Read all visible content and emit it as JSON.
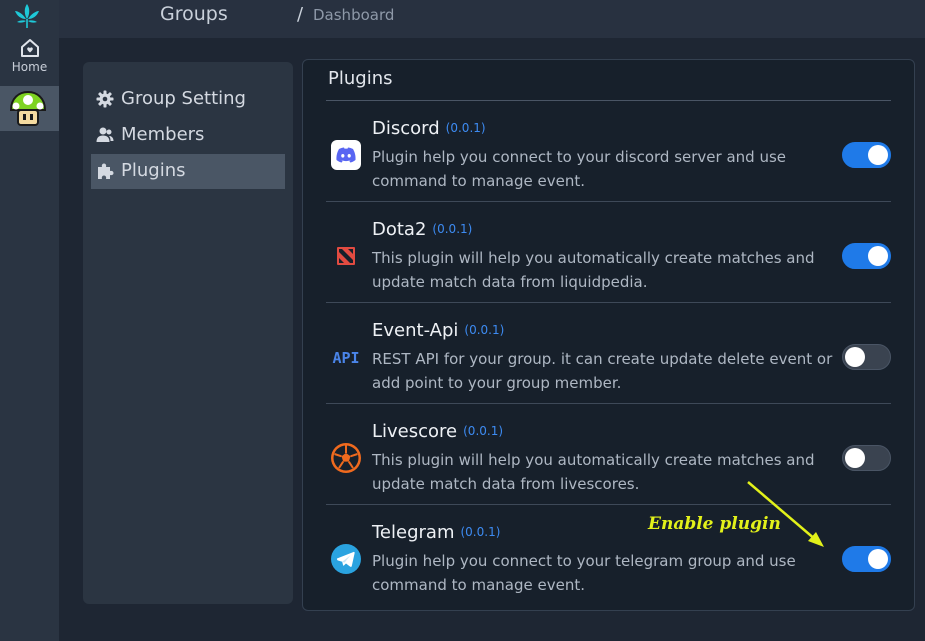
{
  "rail": {
    "home_label": "Home"
  },
  "breadcrumb": {
    "parent": "Groups",
    "separator": "/",
    "current": "Dashboard"
  },
  "sidebar": {
    "items": [
      {
        "label": "Group Setting",
        "icon": "gear-icon",
        "active": false
      },
      {
        "label": "Members",
        "icon": "users-icon",
        "active": false
      },
      {
        "label": "Plugins",
        "icon": "puzzle-icon",
        "active": true
      }
    ]
  },
  "plugins": {
    "title": "Plugins",
    "items": [
      {
        "name": "Discord",
        "version": "(0.0.1)",
        "description": "Plugin help you connect to your discord server and use command to manage event.",
        "icon": "discord-icon",
        "enabled": true
      },
      {
        "name": "Dota2",
        "version": "(0.0.1)",
        "description": "This plugin will help you automatically create matches and update match data from liquidpedia.",
        "icon": "dota2-icon",
        "enabled": true
      },
      {
        "name": "Event-Api",
        "version": "(0.0.1)",
        "description": "REST API for your group. it can create update delete event or add point to your group member.",
        "icon": "api-icon",
        "icon_text": "API",
        "enabled": false
      },
      {
        "name": "Livescore",
        "version": "(0.0.1)",
        "description": "This plugin will help you automatically create matches and update match data from livescores.",
        "icon": "livescore-icon",
        "enabled": false
      },
      {
        "name": "Telegram",
        "version": "(0.0.1)",
        "description": "Plugin help you connect to your telegram group and use command to manage event.",
        "icon": "telegram-icon",
        "enabled": true
      }
    ]
  },
  "annotation": {
    "text": "Enable plugin"
  },
  "colors": {
    "accent": "#1f7ae8",
    "version": "#3d8bf2",
    "annotation": "#e2f11a",
    "panel": "#17202b"
  }
}
